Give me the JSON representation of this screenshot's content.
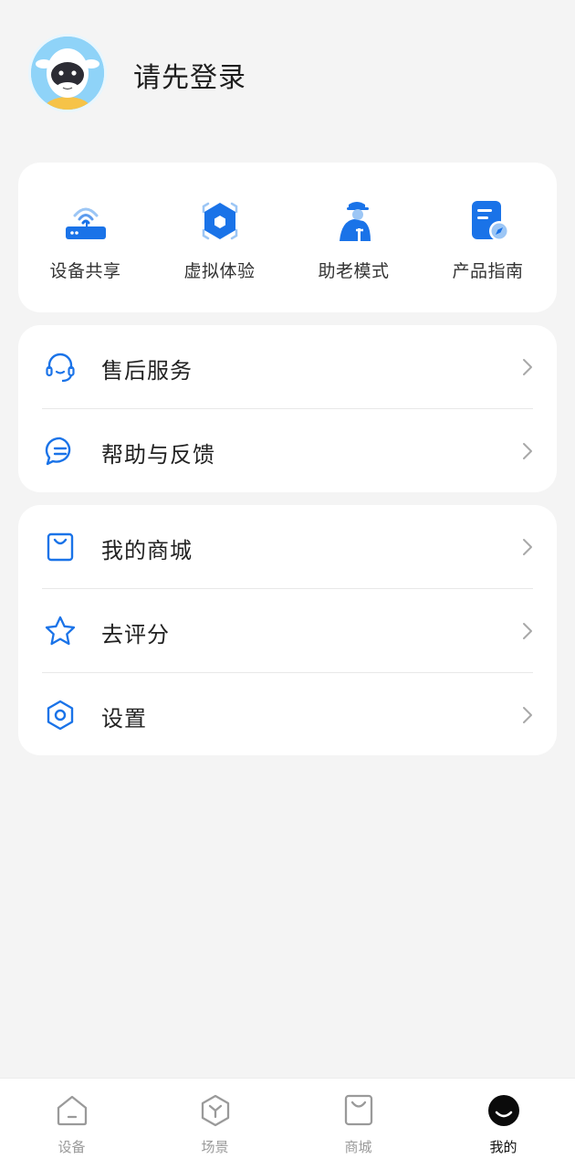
{
  "header": {
    "login_prompt": "请先登录",
    "avatar_icon": "cow-mascot-avatar"
  },
  "quick_actions": [
    {
      "label": "设备共享",
      "icon": "router-share-icon"
    },
    {
      "label": "虚拟体验",
      "icon": "virtual-hexagon-icon"
    },
    {
      "label": "助老模式",
      "icon": "elder-mode-icon"
    },
    {
      "label": "产品指南",
      "icon": "product-guide-icon"
    }
  ],
  "service_menu": [
    {
      "label": "售后服务",
      "icon": "headset-icon"
    },
    {
      "label": "帮助与反馈",
      "icon": "chat-bubble-icon"
    }
  ],
  "shop_menu": [
    {
      "label": "我的商城",
      "icon": "shopping-bag-icon"
    },
    {
      "label": "去评分",
      "icon": "star-icon"
    },
    {
      "label": "设置",
      "icon": "hexagon-settings-icon"
    }
  ],
  "bottom_nav": [
    {
      "label": "设备",
      "icon": "home-icon",
      "active": false
    },
    {
      "label": "场景",
      "icon": "scene-cube-icon",
      "active": false
    },
    {
      "label": "商城",
      "icon": "bag-icon",
      "active": false
    },
    {
      "label": "我的",
      "icon": "profile-face-icon",
      "active": true
    }
  ],
  "colors": {
    "accent": "#1a73e8",
    "background": "#f4f4f4",
    "card": "#ffffff",
    "text_primary": "#222222",
    "nav_inactive": "#9a9a9a"
  }
}
